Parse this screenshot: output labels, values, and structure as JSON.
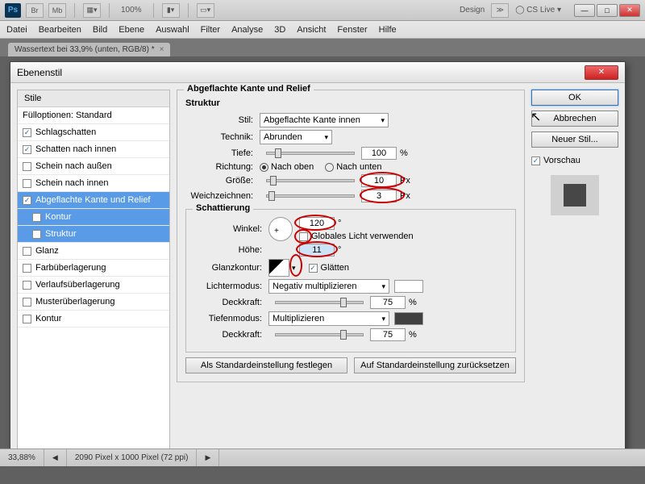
{
  "app": {
    "name": "Ps",
    "zoom": "100%",
    "design_btn": "Design",
    "cslive": "CS Live"
  },
  "menu": [
    "Datei",
    "Bearbeiten",
    "Bild",
    "Ebene",
    "Auswahl",
    "Filter",
    "Analyse",
    "3D",
    "Ansicht",
    "Fenster",
    "Hilfe"
  ],
  "doc_tab": {
    "title": "Wassertext bei 33,9% (unten, RGB/8) *"
  },
  "dialog": {
    "title": "Ebenenstil",
    "styles_header": "Stile",
    "blend_opts": "Fülloptionen: Standard",
    "styles": [
      {
        "label": "Schlagschatten",
        "checked": true
      },
      {
        "label": "Schatten nach innen",
        "checked": true
      },
      {
        "label": "Schein nach außen",
        "checked": false
      },
      {
        "label": "Schein nach innen",
        "checked": false
      },
      {
        "label": "Abgeflachte Kante und Relief",
        "checked": true,
        "selected": true
      },
      {
        "label": "Kontur",
        "checked": false,
        "sub": true,
        "selected": true
      },
      {
        "label": "Struktur",
        "checked": false,
        "sub": true,
        "selected": true
      },
      {
        "label": "Glanz",
        "checked": false
      },
      {
        "label": "Farbüberlagerung",
        "checked": false
      },
      {
        "label": "Verlaufsüberlagerung",
        "checked": false
      },
      {
        "label": "Musterüberlagerung",
        "checked": false
      },
      {
        "label": "Kontur",
        "checked": false
      }
    ],
    "section_title": "Abgeflachte Kante und Relief",
    "structure": {
      "legend": "Struktur",
      "style_label": "Stil:",
      "style_value": "Abgeflachte Kante innen",
      "tech_label": "Technik:",
      "tech_value": "Abrunden",
      "depth_label": "Tiefe:",
      "depth_value": "100",
      "depth_unit": "%",
      "dir_label": "Richtung:",
      "dir_up": "Nach oben",
      "dir_down": "Nach unten",
      "size_label": "Größe:",
      "size_value": "10",
      "size_unit": "Px",
      "soften_label": "Weichzeichnen:",
      "soften_value": "3",
      "soften_unit": "Px"
    },
    "shading": {
      "legend": "Schattierung",
      "angle_label": "Winkel:",
      "angle_value": "120",
      "global_light": "Globales Licht verwenden",
      "alt_label": "Höhe:",
      "alt_value": "11",
      "gloss_label": "Glanzkontur:",
      "aa": "Glätten",
      "hl_mode_label": "Lichtermodus:",
      "hl_mode": "Negativ multiplizieren",
      "hl_opacity_label": "Deckkraft:",
      "hl_opacity": "75",
      "pct": "%",
      "sh_mode_label": "Tiefenmodus:",
      "sh_mode": "Multiplizieren",
      "sh_opacity_label": "Deckkraft:",
      "sh_opacity": "75"
    },
    "btn_default": "Als Standardeinstellung festlegen",
    "btn_reset": "Auf Standardeinstellung zurücksetzen",
    "buttons": {
      "ok": "OK",
      "cancel": "Abbrechen",
      "new_style": "Neuer Stil...",
      "preview": "Vorschau"
    }
  },
  "status": {
    "zoom": "33,88%",
    "dims": "2090 Pixel x 1000 Pixel (72 ppi)"
  }
}
